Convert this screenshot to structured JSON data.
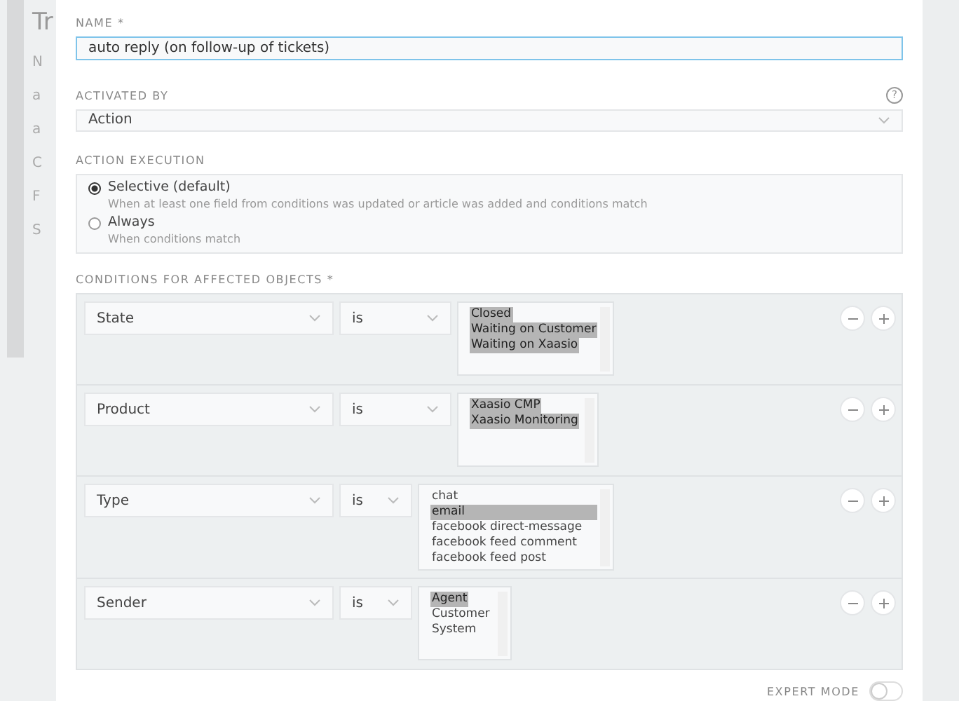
{
  "background_page": {
    "title": "Tr",
    "rows": [
      "N",
      "a",
      "a",
      "C",
      "F",
      "S"
    ]
  },
  "name_field": {
    "label": "NAME *",
    "value": "auto reply (on follow-up of tickets)"
  },
  "activated_by": {
    "label": "ACTIVATED BY",
    "help": "?",
    "value": "Action"
  },
  "action_execution": {
    "label": "ACTION EXECUTION",
    "options": [
      {
        "label": "Selective (default)",
        "description": "When at least one field from conditions was updated or article was added and conditions match",
        "selected": true
      },
      {
        "label": "Always",
        "description": "When conditions match",
        "selected": false
      }
    ]
  },
  "conditions": {
    "label": "CONDITIONS FOR AFFECTED OBJECTS *",
    "rows": [
      {
        "attribute": "State",
        "operator": "is",
        "values": [
          {
            "label": "Closed",
            "selected": true
          },
          {
            "label": "Waiting on Customer",
            "selected": true
          },
          {
            "label": "Waiting on Xaasio",
            "selected": true
          }
        ]
      },
      {
        "attribute": "Product",
        "operator": "is",
        "values": [
          {
            "label": "Xaasio CMP",
            "selected": true
          },
          {
            "label": "Xaasio Monitoring",
            "selected": true
          }
        ]
      },
      {
        "attribute": "Type",
        "operator": "is",
        "values": [
          {
            "label": "chat",
            "selected": false
          },
          {
            "label": "email",
            "selected": true
          },
          {
            "label": "facebook direct-message",
            "selected": false
          },
          {
            "label": "facebook feed comment",
            "selected": false
          },
          {
            "label": "facebook feed post",
            "selected": false
          }
        ]
      },
      {
        "attribute": "Sender",
        "operator": "is",
        "values": [
          {
            "label": "Agent",
            "selected": true
          },
          {
            "label": "Customer",
            "selected": false
          },
          {
            "label": "System",
            "selected": false
          }
        ]
      }
    ]
  },
  "expert_mode": {
    "label": "EXPERT MODE",
    "on": false
  }
}
